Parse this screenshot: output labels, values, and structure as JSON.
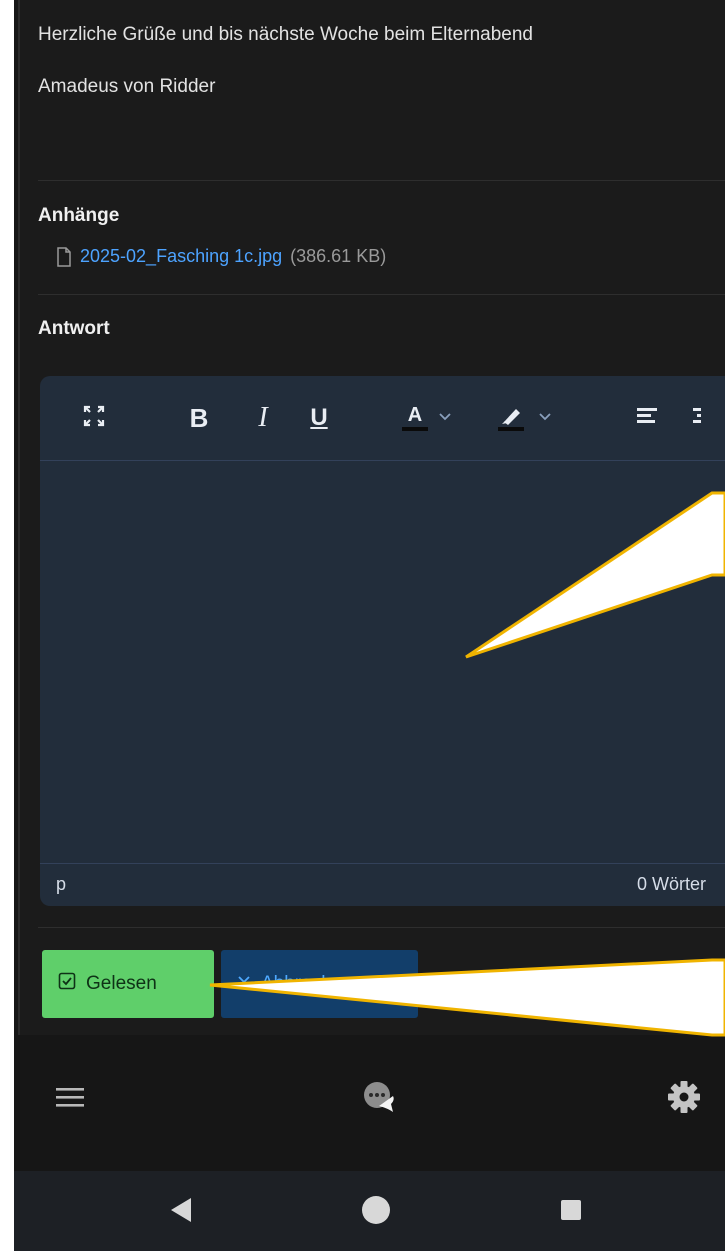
{
  "message": {
    "line1": "Herzliche Grüße und bis nächste Woche beim Elternabend",
    "line2": "Amadeus von Ridder"
  },
  "attachments": {
    "title": "Anhänge",
    "items": [
      {
        "name": "2025-02_Fasching 1c.jpg",
        "size": "(386.61 KB)"
      }
    ]
  },
  "reply": {
    "title": "Antwort",
    "toolbar": {
      "bold": "B",
      "italic": "I",
      "underline": "U",
      "font_color": "A"
    },
    "status_path": "p",
    "word_count": "0 Wörter"
  },
  "buttons": {
    "read": "Gelesen",
    "cancel": "Abbrechen"
  },
  "colors": {
    "read_button": "#5fcf6a",
    "cancel_button": "#123e6a",
    "link": "#4da3ff",
    "editor_bg": "#222d3b",
    "callout_border": "#f0b400"
  },
  "icons": [
    "fullscreen-icon",
    "text-color-icon",
    "highlighter-icon",
    "align-left-icon",
    "file-icon",
    "checkbox-icon",
    "close-icon",
    "menu-icon",
    "chat-icon",
    "gear-icon",
    "back-icon",
    "home-icon",
    "recents-icon"
  ]
}
